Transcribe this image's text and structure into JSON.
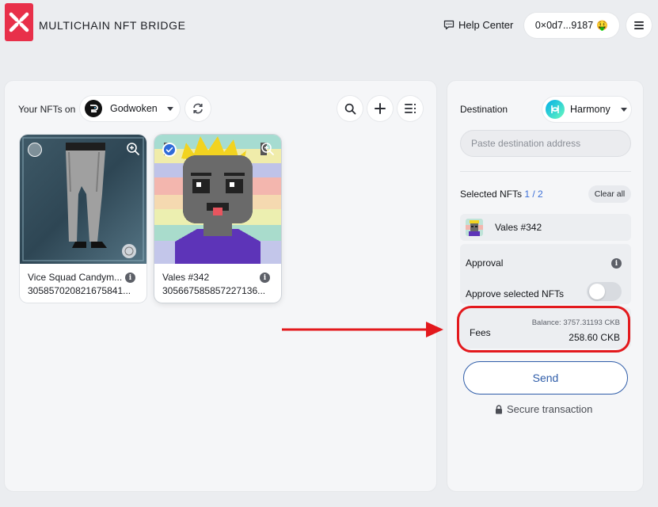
{
  "header": {
    "brand": "MULTICHAIN NFT BRIDGE",
    "help_center": "Help Center",
    "wallet_address": "0×0d7...9187",
    "wallet_emoji": "🤑"
  },
  "nft_panel": {
    "label": "Your NFTs on",
    "chain": "Godwoken",
    "cards": [
      {
        "name": "Vice Squad Candym...",
        "id": "305857020821675841...",
        "selected": false
      },
      {
        "name": "Vales #342",
        "id": "305667585857227136...",
        "selected": true
      }
    ]
  },
  "transfer_panel": {
    "destination_label": "Destination",
    "destination_chain": "Harmony",
    "address_placeholder": "Paste destination address",
    "selected_label": "Selected NFTs",
    "selected_count": "1 / 2",
    "clear_all": "Clear all",
    "selected_items": [
      {
        "name": "Vales #342"
      }
    ],
    "approval_label": "Approval",
    "approve_label": "Approve selected NFTs",
    "approve_enabled": false,
    "fees_label": "Fees",
    "balance": "Balance: 3757.31193 CKB",
    "fee_amount": "258.60 CKB",
    "send_label": "Send",
    "secure_label": "Secure transaction"
  },
  "colors": {
    "brand": "#e8304a",
    "accent": "#2f5da9",
    "highlight": "#e3191d"
  }
}
